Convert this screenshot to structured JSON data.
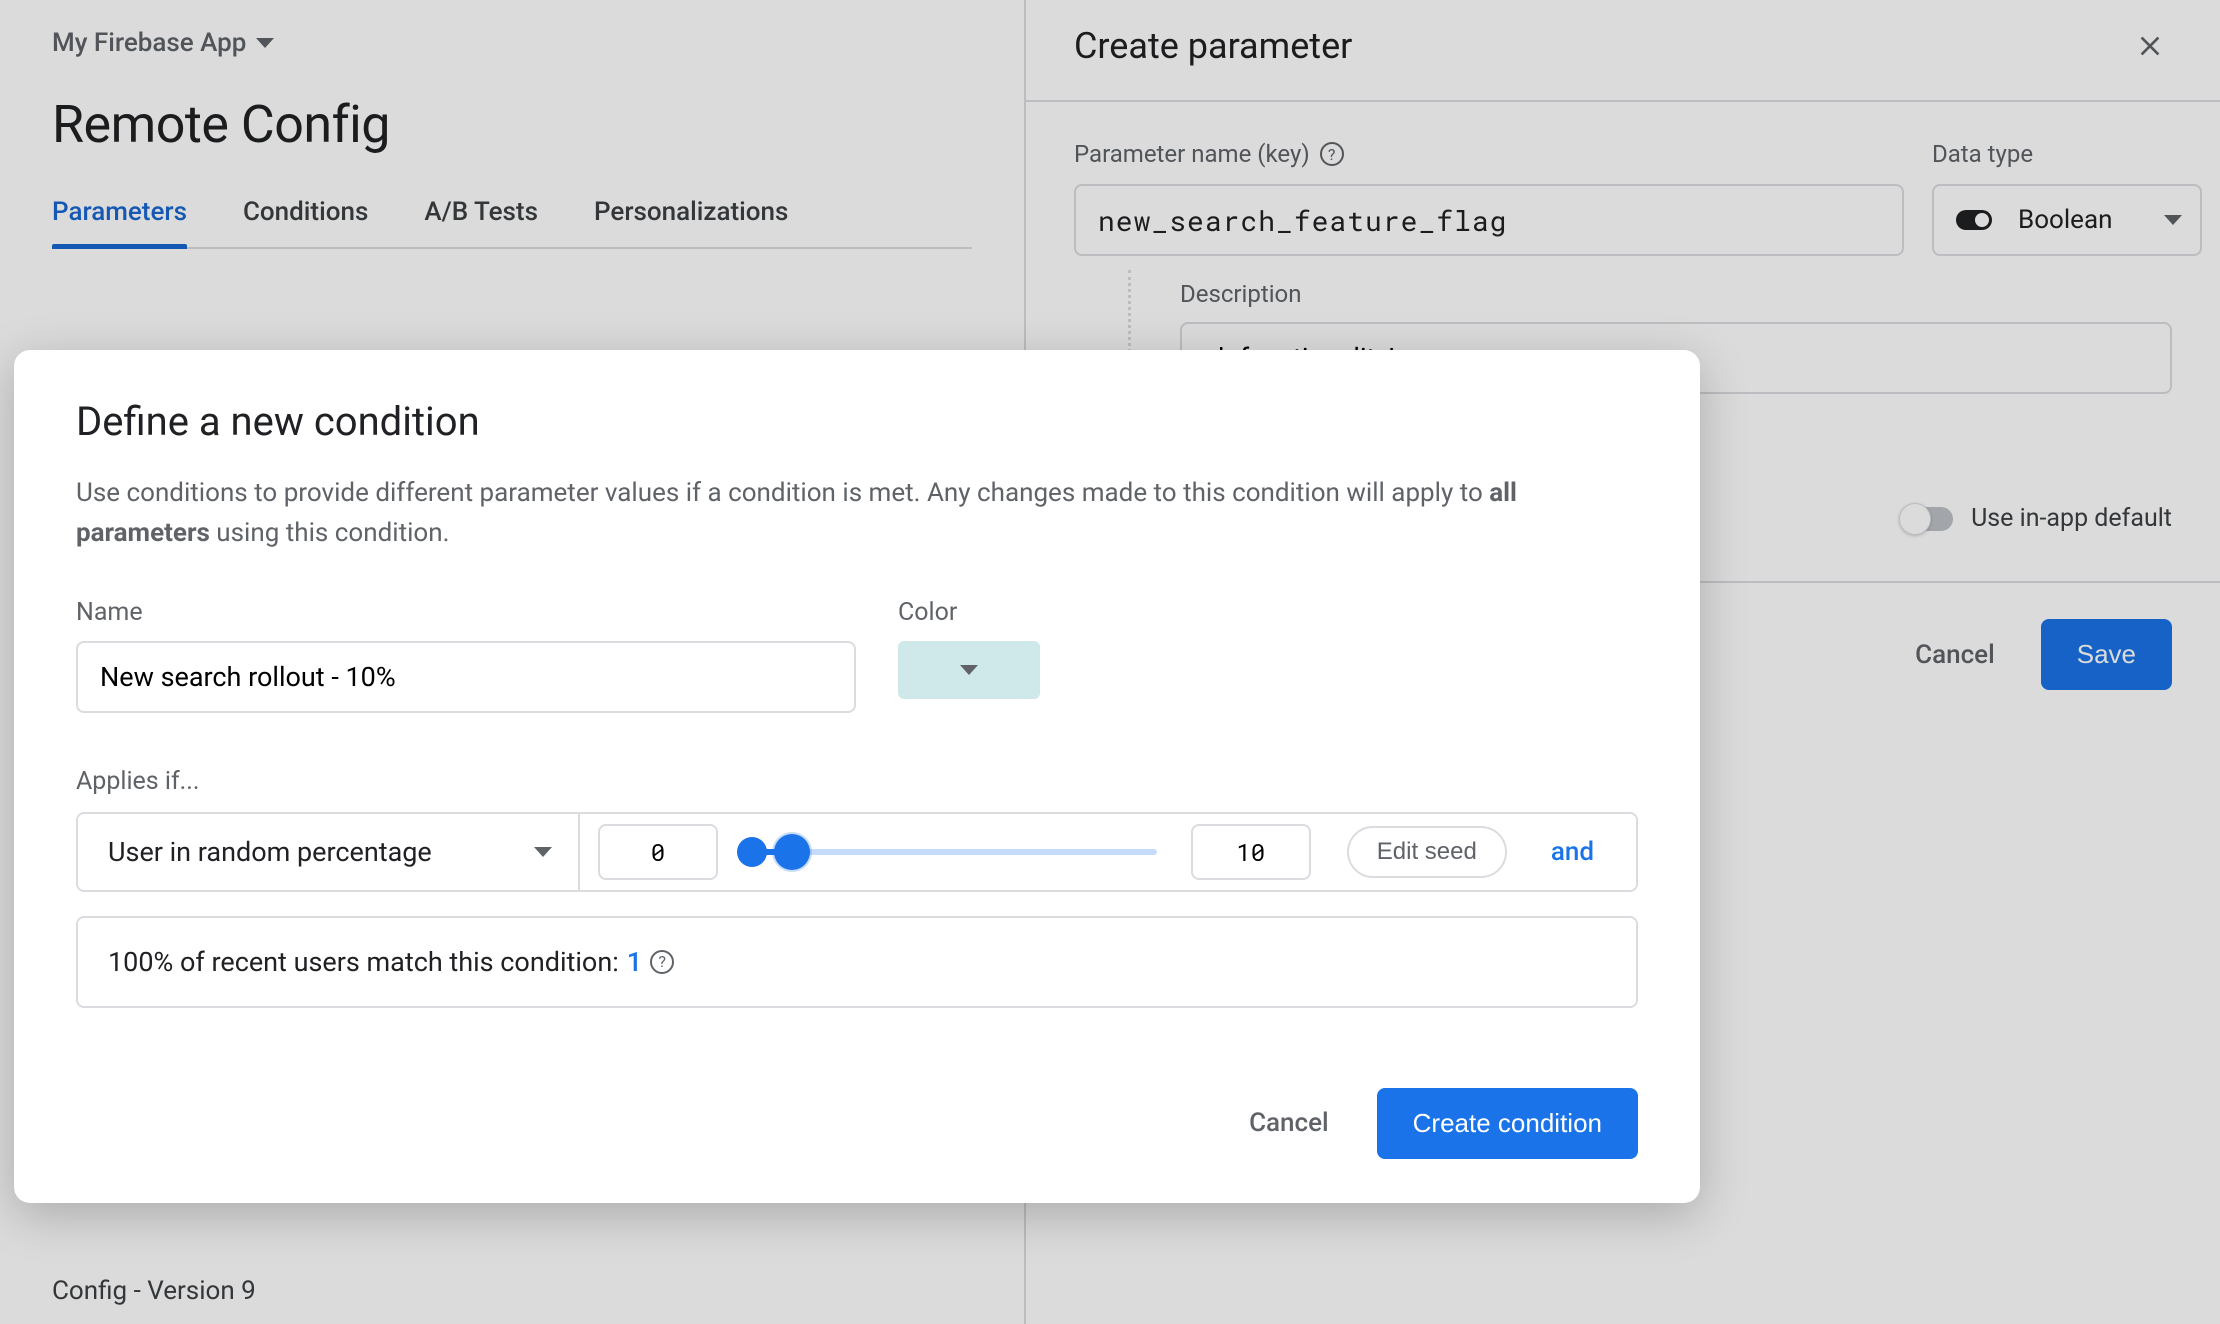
{
  "header": {
    "app_name": "My Firebase App",
    "page_title": "Remote Config",
    "config_version": "Config - Version 9"
  },
  "tabs": [
    {
      "label": "Parameters",
      "active": true
    },
    {
      "label": "Conditions",
      "active": false
    },
    {
      "label": "A/B Tests",
      "active": false
    },
    {
      "label": "Personalizations",
      "active": false
    }
  ],
  "side_panel": {
    "title": "Create parameter",
    "param_name_label": "Parameter name (key)",
    "param_name_value": "new_search_feature_flag",
    "data_type_label": "Data type",
    "data_type_value": "Boolean",
    "description_label": "Description",
    "description_value": "ch functionality!",
    "use_in_app_default_label": "Use in-app default",
    "cancel_label": "Cancel",
    "save_label": "Save"
  },
  "modal": {
    "title": "Define a new condition",
    "subtext_prefix": "Use conditions to provide different parameter values if a condition is met. Any changes made to this condition will apply to ",
    "subtext_bold": "all parameters",
    "subtext_suffix": " using this condition.",
    "name_label": "Name",
    "name_value": "New search rollout - 10%",
    "color_label": "Color",
    "color_value": "#cfe8ea",
    "applies_label": "Applies if...",
    "rule_type": "User in random percentage",
    "range_low": "0",
    "range_high": "10",
    "edit_seed_label": "Edit seed",
    "and_label": "and",
    "match_text": "100% of recent users match this condition: ",
    "match_count": "1",
    "cancel_label": "Cancel",
    "create_label": "Create condition"
  }
}
